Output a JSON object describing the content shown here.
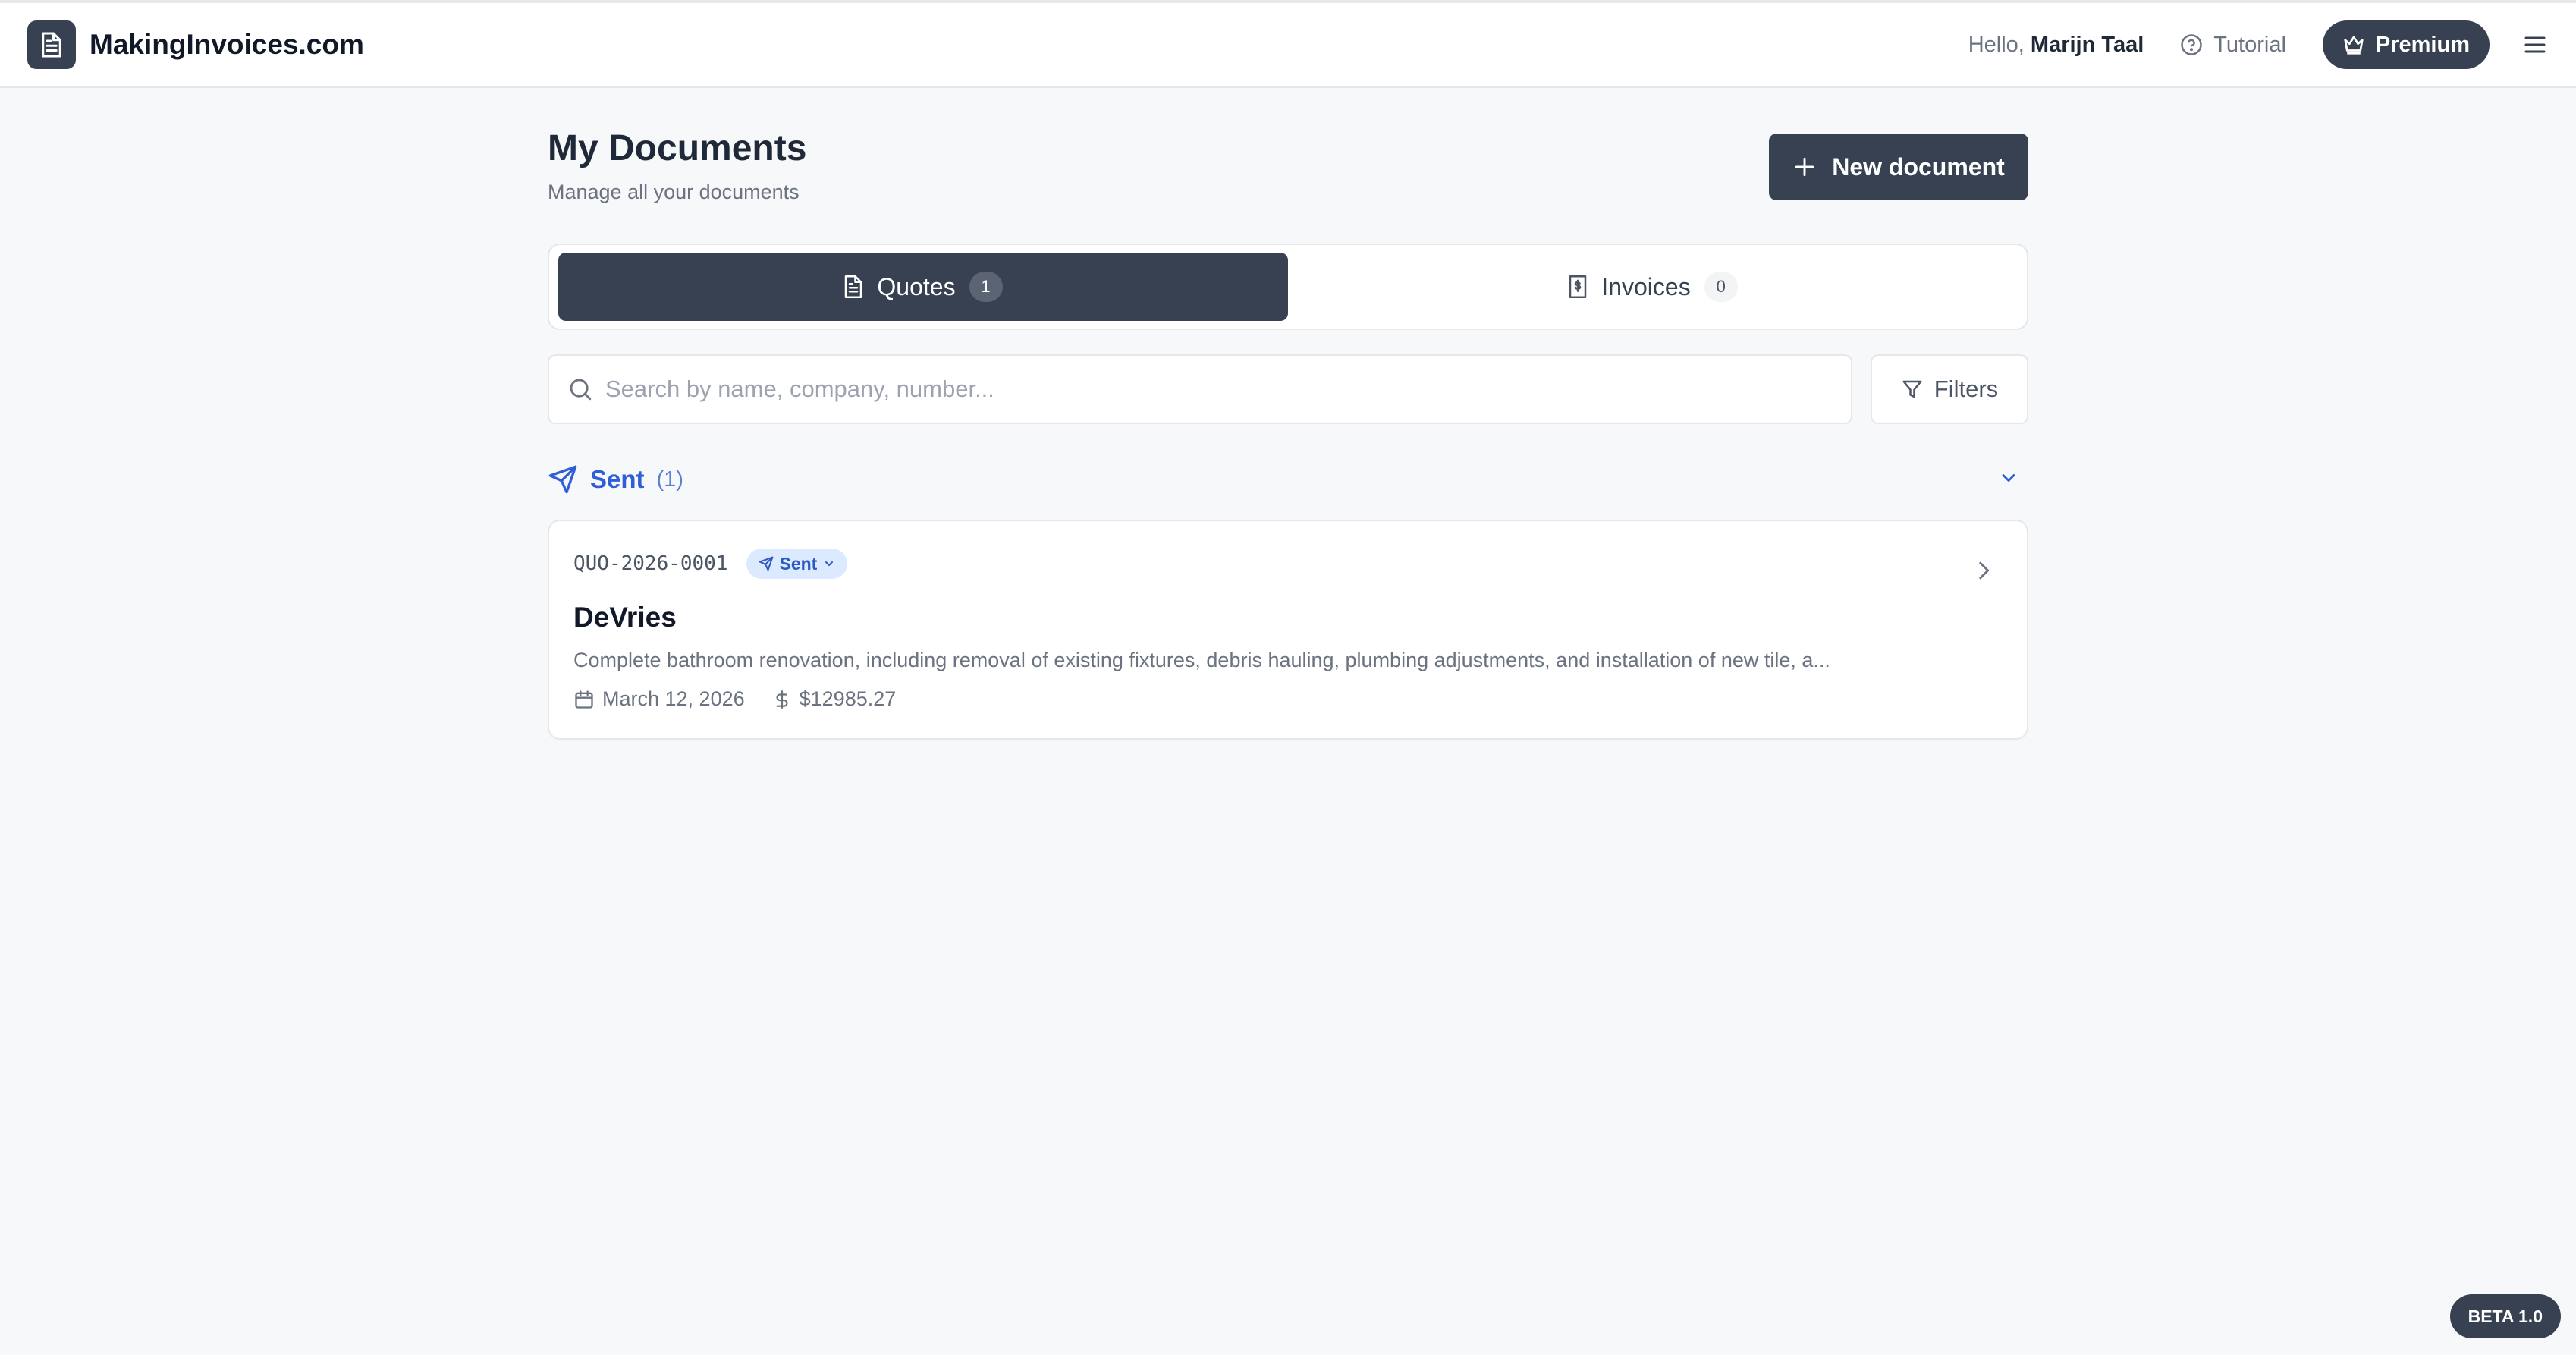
{
  "app": {
    "brand": "MakingInvoices.com"
  },
  "header": {
    "greeting": "Hello,",
    "user_name": "Marijn Taal",
    "tutorial_label": "Tutorial",
    "premium_label": "Premium"
  },
  "page": {
    "title": "My Documents",
    "subtitle": "Manage all your documents",
    "new_document_label": "New document"
  },
  "tabs": [
    {
      "label": "Quotes",
      "count": "1",
      "active": true
    },
    {
      "label": "Invoices",
      "count": "0",
      "active": false
    }
  ],
  "search": {
    "placeholder": "Search by name, company, number...",
    "value": ""
  },
  "filters_label": "Filters",
  "section": {
    "name": "Sent",
    "count": "(1)"
  },
  "documents": [
    {
      "number": "QUO-2026-0001",
      "status": "Sent",
      "client": "DeVries",
      "description": "Complete bathroom renovation, including removal of existing fixtures, debris hauling, plumbing adjustments, and installation of new tile, a...",
      "date": "March 12, 2026",
      "amount": "$12985.27"
    }
  ],
  "beta_label": "BETA 1.0",
  "colors": {
    "primary_dark": "#374151",
    "accent_blue": "#2f5ed8",
    "badge_bg": "#dbeafe",
    "background": "#f7f8fa"
  },
  "icons": [
    "document-icon",
    "help-circle-icon",
    "crown-icon",
    "menu-icon",
    "plus-icon",
    "file-text-icon",
    "receipt-icon",
    "search-icon",
    "filter-icon",
    "send-icon",
    "chevron-down-icon",
    "chevron-right-icon",
    "calendar-icon",
    "dollar-icon"
  ]
}
